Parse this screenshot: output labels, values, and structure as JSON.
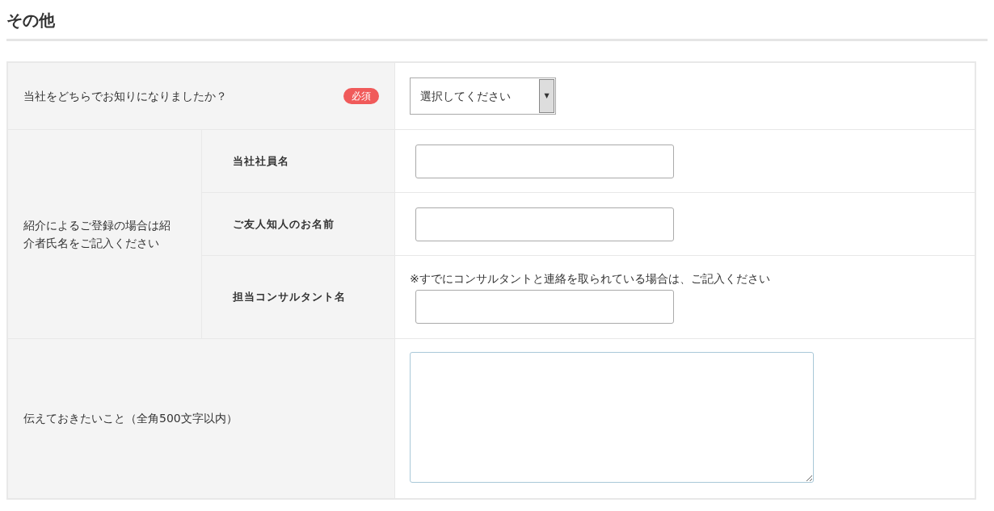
{
  "section_title": "その他",
  "source_row": {
    "label": "当社をどちらでお知りになりましたか？",
    "required_badge": "必須",
    "select": {
      "value": "選択してください",
      "arrow": "▼"
    }
  },
  "referral": {
    "label": "紹介によるご登録の場合は紹介者氏名をご記入ください",
    "fields": [
      {
        "label": "当社社員名"
      },
      {
        "label": "ご友人知人のお名前"
      },
      {
        "label": "担当コンサルタント名",
        "note": "※すでにコンサルタントと連絡を取られている場合は、ご記入ください"
      }
    ]
  },
  "message_row": {
    "label": "伝えておきたいこと（全角500文字以内）"
  }
}
